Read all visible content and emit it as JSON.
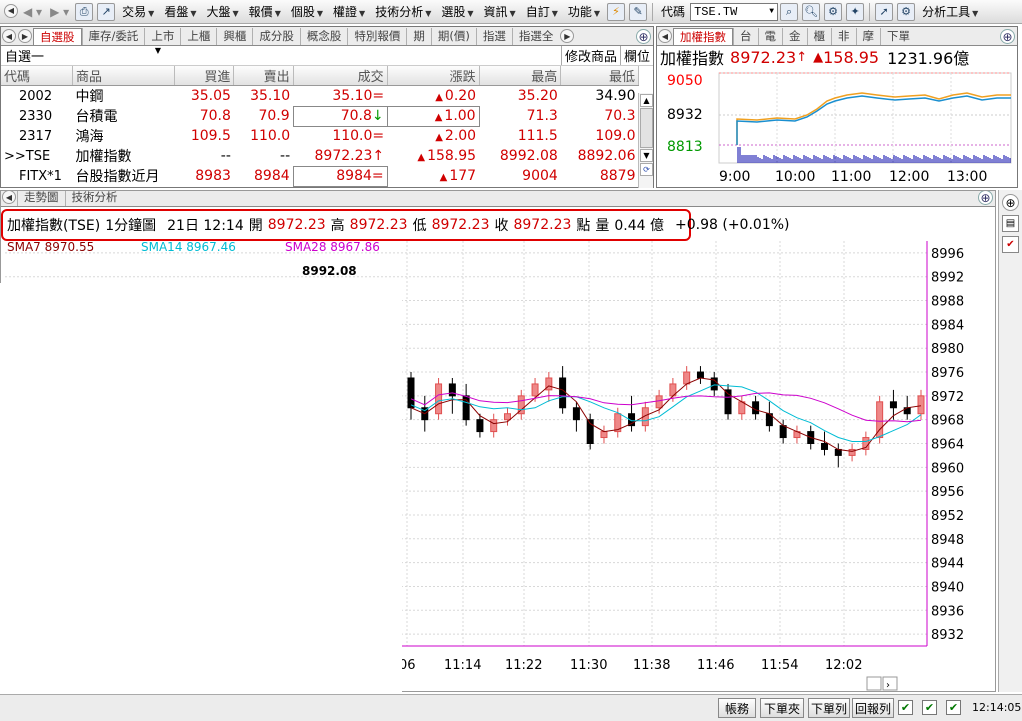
{
  "toolbar": {
    "menus": [
      "交易",
      "看盤",
      "大盤",
      "報價",
      "個股",
      "權證",
      "技術分析",
      "選股",
      "資訊",
      "自訂",
      "功能"
    ],
    "code_label": "代碼",
    "code_value": "TSE.TW",
    "analysis_tools": "分析工具"
  },
  "quote": {
    "tabs": [
      "自選股",
      "庫存/委託",
      "上市",
      "上櫃",
      "興櫃",
      "成分股",
      "概念股",
      "特別報價",
      "期",
      "期(價)",
      "指選",
      "指選全"
    ],
    "group": "自選一",
    "actions": [
      "修改商品",
      "欄位"
    ],
    "columns": [
      "代碼",
      "商品",
      "買進",
      "賣出",
      "成交",
      "漲跌",
      "最高",
      "最低"
    ],
    "rows": [
      {
        "code": "2002",
        "name": "中鋼",
        "bid": "35.05",
        "ask": "35.10",
        "last": "35.10",
        "last_mark": "=",
        "chg": "0.20",
        "high": "35.20",
        "low": "34.90"
      },
      {
        "code": "2330",
        "name": "台積電",
        "bid": "70.8",
        "ask": "70.9",
        "last": "70.8",
        "last_mark": "↓",
        "chg": "1.00",
        "high": "71.3",
        "low": "70.3"
      },
      {
        "code": "2317",
        "name": "鴻海",
        "bid": "109.5",
        "ask": "110.0",
        "last": "110.0",
        "last_mark": "=",
        "chg": "2.00",
        "high": "111.5",
        "low": "109.0"
      },
      {
        "code": ">>TSE",
        "name": "加權指數",
        "bid": "--",
        "ask": "--",
        "last": "8972.23",
        "last_mark": "↑",
        "chg": "158.95",
        "high": "8992.08",
        "low": "8892.06"
      },
      {
        "code": "FITX*1",
        "name": "台股指數近月",
        "bid": "8983",
        "ask": "8984",
        "last": "8984",
        "last_mark": "=",
        "chg": "177",
        "high": "9004",
        "low": "8879"
      }
    ]
  },
  "index_panel": {
    "tabs": [
      "加權指數",
      "台",
      "電",
      "金",
      "櫃",
      "非",
      "摩",
      "下單"
    ],
    "title": "加權指數",
    "value": "8972.23",
    "change": "158.95",
    "volume": "1231.96億",
    "y_labels": [
      "9050",
      "8932",
      "8813"
    ],
    "x_labels": [
      "9:00",
      "10:00",
      "11:00",
      "12:00",
      "13:00"
    ],
    "colors": {
      "ref_up": "#ff0000",
      "ref_mid": "#000000",
      "ref_low": "#009900"
    }
  },
  "main_chart": {
    "tabs": [
      "走勢圖",
      "技術分析"
    ],
    "info": {
      "symbol": "加權指數(TSE)",
      "period": "1分鐘圖",
      "datetime": "21日 12:14",
      "open_label": "開",
      "open": "8972.23",
      "high_label": "高",
      "high": "8972.23",
      "low_label": "低",
      "low": "8972.23",
      "close_label": "收",
      "close": "8972.23",
      "points_label": "點",
      "vol_label": "量",
      "vol": "0.44 億",
      "change": "+0.98 (+0.01%)"
    },
    "ma_legend": [
      {
        "label": "SMA7 8970.55",
        "color": "#8b0000"
      },
      {
        "label": "SMA14 8967.46",
        "color": "#00bcd4"
      },
      {
        "label": "SMA28 8967.86",
        "color": "#cc00cc"
      }
    ],
    "max_label": "8992.08",
    "y_labels": [
      "8996",
      "8992",
      "8988",
      "8984",
      "8980",
      "8976",
      "8972",
      "8968",
      "8964",
      "8960",
      "8956",
      "8952",
      "8948",
      "8944",
      "8940",
      "8936",
      "8932"
    ],
    "x_labels": [
      "06",
      "11:14",
      "11:22",
      "11:30",
      "11:38",
      "11:46",
      "11:54",
      "12:02"
    ]
  },
  "chart_data": {
    "type": "candlestick",
    "title": "加權指數(TSE) 1分鐘圖",
    "xlabel": "",
    "ylabel": "",
    "ylim": [
      8930,
      8998
    ],
    "candles": [
      {
        "o": 8975,
        "h": 8976,
        "l": 8968,
        "c": 8970
      },
      {
        "o": 8970,
        "h": 8972,
        "l": 8966,
        "c": 8968
      },
      {
        "o": 8969,
        "h": 8975,
        "l": 8968,
        "c": 8974
      },
      {
        "o": 8974,
        "h": 8975,
        "l": 8969,
        "c": 8972
      },
      {
        "o": 8972,
        "h": 8974,
        "l": 8967,
        "c": 8968
      },
      {
        "o": 8968,
        "h": 8969,
        "l": 8965,
        "c": 8966
      },
      {
        "o": 8966,
        "h": 8969,
        "l": 8965,
        "c": 8968
      },
      {
        "o": 8968,
        "h": 8970,
        "l": 8967,
        "c": 8969
      },
      {
        "o": 8969,
        "h": 8973,
        "l": 8968,
        "c": 8972
      },
      {
        "o": 8972,
        "h": 8975,
        "l": 8971,
        "c": 8974
      },
      {
        "o": 8973,
        "h": 8976,
        "l": 8971,
        "c": 8975
      },
      {
        "o": 8975,
        "h": 8977,
        "l": 8969,
        "c": 8970
      },
      {
        "o": 8970,
        "h": 8971,
        "l": 8966,
        "c": 8968
      },
      {
        "o": 8968,
        "h": 8969,
        "l": 8963,
        "c": 8964
      },
      {
        "o": 8965,
        "h": 8967,
        "l": 8964,
        "c": 8966
      },
      {
        "o": 8966,
        "h": 8970,
        "l": 8965,
        "c": 8969
      },
      {
        "o": 8969,
        "h": 8972,
        "l": 8966,
        "c": 8967
      },
      {
        "o": 8967,
        "h": 8971,
        "l": 8966,
        "c": 8970
      },
      {
        "o": 8970,
        "h": 8973,
        "l": 8969,
        "c": 8972
      },
      {
        "o": 8972,
        "h": 8975,
        "l": 8971,
        "c": 8974
      },
      {
        "o": 8974,
        "h": 8977,
        "l": 8973,
        "c": 8976
      },
      {
        "o": 8976,
        "h": 8977,
        "l": 8974,
        "c": 8975
      },
      {
        "o": 8975,
        "h": 8976,
        "l": 8972,
        "c": 8973
      },
      {
        "o": 8973,
        "h": 8974,
        "l": 8968,
        "c": 8969
      },
      {
        "o": 8969,
        "h": 8972,
        "l": 8968,
        "c": 8971
      },
      {
        "o": 8971,
        "h": 8972,
        "l": 8968,
        "c": 8969
      },
      {
        "o": 8969,
        "h": 8971,
        "l": 8966,
        "c": 8967
      },
      {
        "o": 8967,
        "h": 8968,
        "l": 8964,
        "c": 8965
      },
      {
        "o": 8965,
        "h": 8967,
        "l": 8964,
        "c": 8966
      },
      {
        "o": 8966,
        "h": 8967,
        "l": 8963,
        "c": 8964
      },
      {
        "o": 8964,
        "h": 8966,
        "l": 8962,
        "c": 8963
      },
      {
        "o": 8963,
        "h": 8964,
        "l": 8960,
        "c": 8962
      },
      {
        "o": 8962,
        "h": 8964,
        "l": 8961,
        "c": 8963
      },
      {
        "o": 8963,
        "h": 8966,
        "l": 8962,
        "c": 8965
      },
      {
        "o": 8965,
        "h": 8972,
        "l": 8964,
        "c": 8971
      },
      {
        "o": 8971,
        "h": 8973,
        "l": 8968,
        "c": 8970
      },
      {
        "o": 8970,
        "h": 8972,
        "l": 8968,
        "c": 8969
      },
      {
        "o": 8969,
        "h": 8973,
        "l": 8968,
        "c": 8972
      }
    ]
  },
  "bottom": {
    "buttons": [
      "帳務",
      "下單夾",
      "下單列",
      "回報列"
    ],
    "time": "12:14:05"
  }
}
